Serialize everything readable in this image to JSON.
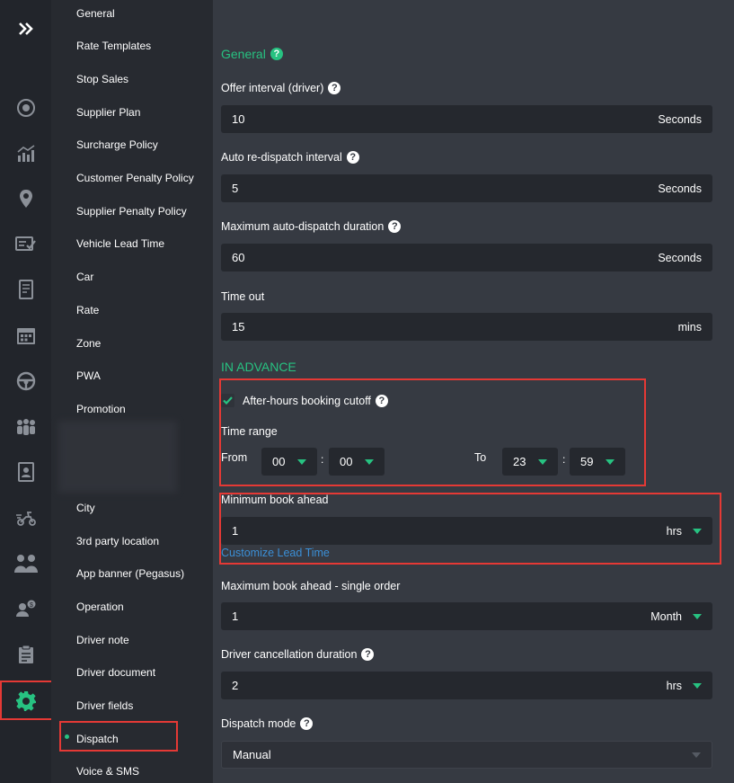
{
  "rail": {
    "items": [
      {
        "icon": "chevrons-right-icon"
      },
      {
        "icon": "target-icon"
      },
      {
        "icon": "chart-icon"
      },
      {
        "icon": "location-pin-icon"
      },
      {
        "icon": "checklist-icon"
      },
      {
        "icon": "document-icon"
      },
      {
        "icon": "calendar-icon"
      },
      {
        "icon": "steering-wheel-icon"
      },
      {
        "icon": "group-icon"
      },
      {
        "icon": "contact-card-icon"
      },
      {
        "icon": "scooter-icon"
      },
      {
        "icon": "people-icon"
      },
      {
        "icon": "user-dollar-icon"
      },
      {
        "icon": "clipboard-icon"
      },
      {
        "icon": "gear-icon"
      }
    ],
    "active_color": "#27c281"
  },
  "subnav": {
    "items": [
      "General",
      "Rate Templates",
      "Stop Sales",
      "Supplier Plan",
      "Surcharge Policy",
      "Customer Penalty Policy",
      "Supplier Penalty Policy",
      "Vehicle Lead Time",
      "Car",
      "Rate",
      "Zone",
      "PWA",
      "Promotion",
      "City",
      "3rd party location",
      "App banner (Pegasus)",
      "Operation",
      "Driver note",
      "Driver document",
      "Driver fields",
      "Dispatch",
      "Voice & SMS"
    ],
    "active": "Dispatch"
  },
  "general": {
    "title": "General",
    "offer_interval": {
      "label": "Offer interval (driver)",
      "value": "10",
      "unit": "Seconds"
    },
    "auto_redispatch": {
      "label": "Auto re-dispatch interval",
      "value": "5",
      "unit": "Seconds"
    },
    "max_auto_dispatch": {
      "label": "Maximum auto-dispatch duration",
      "value": "60",
      "unit": "Seconds"
    },
    "time_out": {
      "label": "Time out",
      "value": "15",
      "unit": "mins"
    }
  },
  "in_advance": {
    "title": "IN ADVANCE",
    "cutoff_label": "After-hours booking cutoff",
    "cutoff_checked": true,
    "time_range_label": "Time range",
    "from_label": "From",
    "to_label": "To",
    "from_hour": "00",
    "from_min": "00",
    "to_hour": "23",
    "to_min": "59",
    "colon": ":",
    "min_book_ahead": {
      "label": "Minimum book ahead",
      "value": "1",
      "unit": "hrs"
    },
    "customize_link": "Customize Lead Time",
    "max_book_ahead": {
      "label": "Maximum book ahead - single order",
      "value": "1",
      "unit": "Month"
    },
    "driver_cancel": {
      "label": "Driver cancellation duration",
      "value": "2",
      "unit": "hrs"
    },
    "dispatch_mode": {
      "label": "Dispatch mode",
      "value": "Manual"
    }
  },
  "colors": {
    "accent": "#27c281",
    "highlight": "#e53935",
    "link": "#3b8fd6"
  }
}
